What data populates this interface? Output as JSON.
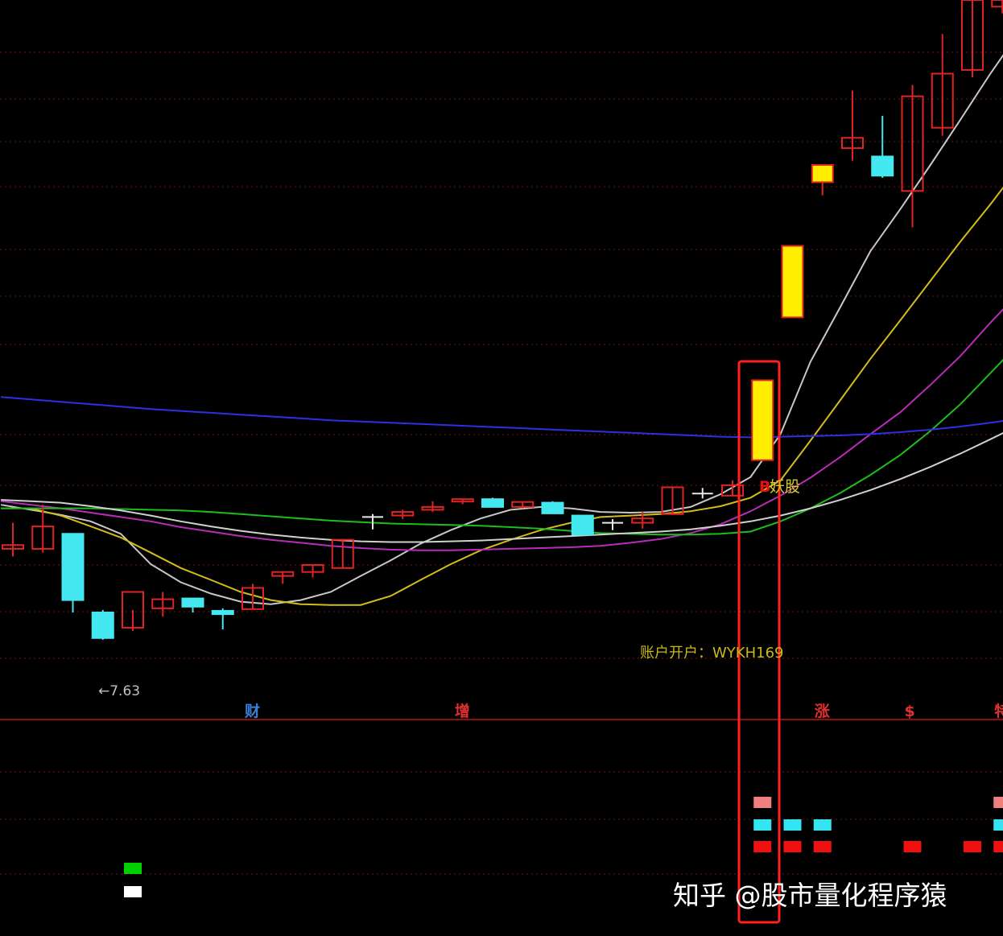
{
  "chart_data": {
    "type": "candlestick",
    "y_scale": "log",
    "y_range": [
      7.0,
      20.0
    ],
    "grid": true,
    "low_label": "←7.63",
    "candles": [
      {
        "o": 8.8,
        "h": 9.1,
        "l": 8.65,
        "c": 8.75,
        "style": "hollow-red"
      },
      {
        "o": 8.75,
        "h": 9.35,
        "l": 8.7,
        "c": 9.05,
        "style": "hollow-red"
      },
      {
        "o": 8.95,
        "h": 8.95,
        "l": 7.95,
        "c": 8.1,
        "style": "solid-cyan"
      },
      {
        "o": 7.95,
        "h": 7.98,
        "l": 7.63,
        "c": 7.65,
        "style": "solid-cyan"
      },
      {
        "o": 7.77,
        "h": 7.98,
        "l": 7.73,
        "c": 8.2,
        "style": "hollow-red"
      },
      {
        "o": 8.0,
        "h": 8.2,
        "l": 7.9,
        "c": 8.11,
        "style": "hollow-red"
      },
      {
        "o": 8.12,
        "h": 8.12,
        "l": 7.95,
        "c": 8.02,
        "style": "solid-cyan"
      },
      {
        "o": 7.97,
        "h": 8.0,
        "l": 7.75,
        "c": 7.93,
        "style": "solid-cyan"
      },
      {
        "o": 7.99,
        "h": 8.3,
        "l": 7.99,
        "c": 8.25,
        "style": "hollow-red"
      },
      {
        "o": 8.4,
        "h": 8.45,
        "l": 8.3,
        "c": 8.45,
        "style": "hollow-red"
      },
      {
        "o": 8.45,
        "h": 8.55,
        "l": 8.38,
        "c": 8.54,
        "style": "hollow-red"
      },
      {
        "o": 8.5,
        "h": 8.87,
        "l": 8.5,
        "c": 8.87,
        "style": "hollow-red"
      },
      {
        "o": 9.18,
        "h": 9.22,
        "l": 9.01,
        "c": 9.18,
        "style": "doji"
      },
      {
        "o": 9.2,
        "h": 9.28,
        "l": 9.15,
        "c": 9.25,
        "style": "hollow-red"
      },
      {
        "o": 9.28,
        "h": 9.4,
        "l": 9.25,
        "c": 9.32,
        "style": "hollow-red"
      },
      {
        "o": 9.4,
        "h": 9.43,
        "l": 9.36,
        "c": 9.43,
        "style": "hollow-red"
      },
      {
        "o": 9.43,
        "h": 9.45,
        "l": 9.32,
        "c": 9.32,
        "style": "solid-cyan"
      },
      {
        "o": 9.32,
        "h": 9.4,
        "l": 9.3,
        "c": 9.39,
        "style": "hollow-red"
      },
      {
        "o": 9.38,
        "h": 9.4,
        "l": 9.23,
        "c": 9.23,
        "style": "solid-cyan"
      },
      {
        "o": 9.2,
        "h": 9.2,
        "l": 8.93,
        "c": 8.94,
        "style": "solid-cyan"
      },
      {
        "o": 9.1,
        "h": 9.15,
        "l": 9.0,
        "c": 9.1,
        "style": "doji"
      },
      {
        "o": 9.1,
        "h": 9.25,
        "l": 9.02,
        "c": 9.16,
        "style": "hollow-red"
      },
      {
        "o": 9.22,
        "h": 9.6,
        "l": 9.22,
        "c": 9.6,
        "style": "hollow-red"
      },
      {
        "o": 9.51,
        "h": 9.59,
        "l": 9.44,
        "c": 9.51,
        "style": "doji"
      },
      {
        "o": 9.48,
        "h": 9.7,
        "l": 9.48,
        "c": 9.63,
        "style": "hollow-red"
      },
      {
        "o": 10.0,
        "h": 11.28,
        "l": 10.0,
        "c": 11.28,
        "style": "solid-yellow"
      },
      {
        "o": 12.4,
        "h": 13.81,
        "l": 12.4,
        "c": 13.81,
        "style": "solid-yellow"
      },
      {
        "o": 15.2,
        "h": 15.6,
        "l": 14.9,
        "c": 15.6,
        "style": "solid-yellow"
      },
      {
        "o": 16.0,
        "h": 17.45,
        "l": 15.7,
        "c": 16.25,
        "style": "hollow-red"
      },
      {
        "o": 15.8,
        "h": 16.8,
        "l": 15.3,
        "c": 15.35,
        "style": "solid-cyan"
      },
      {
        "o": 15.0,
        "h": 17.6,
        "l": 14.2,
        "c": 17.3,
        "style": "hollow-red"
      },
      {
        "o": 16.5,
        "h": 19.0,
        "l": 16.3,
        "c": 17.9,
        "style": "hollow-red"
      },
      {
        "o": 18.0,
        "h": 20.0,
        "l": 17.8,
        "c": 20.0,
        "style": "hollow-red"
      },
      {
        "o": 19.8,
        "h": 20.0,
        "l": 19.6,
        "c": 20.0,
        "style": "hollow-red"
      }
    ],
    "ma_lines": [
      {
        "color": "#c8c8c8",
        "values": [
          9.35,
          9.28,
          9.21,
          9.12,
          8.95,
          8.55,
          8.32,
          8.18,
          8.08,
          8.05,
          8.1,
          8.2,
          8.4,
          8.6,
          8.82,
          9.0,
          9.16,
          9.28,
          9.32,
          9.3,
          9.25,
          9.24,
          9.25,
          9.32,
          9.5,
          9.75,
          10.4,
          11.6,
          12.6,
          13.7,
          14.6,
          15.6,
          16.7,
          17.9,
          19.1
        ]
      },
      {
        "color": "#d4bd1a",
        "values": [
          9.3,
          9.3,
          9.2,
          9.05,
          8.9,
          8.7,
          8.5,
          8.35,
          8.2,
          8.1,
          8.05,
          8.04,
          8.04,
          8.15,
          8.35,
          8.55,
          8.73,
          8.87,
          9.0,
          9.1,
          9.18,
          9.2,
          9.22,
          9.26,
          9.33,
          9.45,
          9.7,
          10.3,
          10.95,
          11.65,
          12.35,
          13.1,
          13.9,
          14.7,
          15.6
        ]
      },
      {
        "color": "#b82cb8",
        "values": [
          9.4,
          9.35,
          9.3,
          9.24,
          9.18,
          9.12,
          9.04,
          8.98,
          8.92,
          8.87,
          8.83,
          8.79,
          8.76,
          8.74,
          8.73,
          8.73,
          8.74,
          8.75,
          8.76,
          8.77,
          8.79,
          8.83,
          8.88,
          8.96,
          9.08,
          9.26,
          9.48,
          9.74,
          10.05,
          10.4,
          10.75,
          11.2,
          11.7,
          12.3,
          12.9
        ]
      },
      {
        "color": "#1cbd1c",
        "values": [
          9.3,
          9.3,
          9.3,
          9.3,
          9.29,
          9.28,
          9.27,
          9.25,
          9.22,
          9.19,
          9.16,
          9.13,
          9.11,
          9.09,
          9.08,
          9.07,
          9.06,
          9.04,
          9.02,
          8.99,
          8.96,
          8.95,
          8.94,
          8.94,
          8.95,
          8.98,
          9.12,
          9.3,
          9.52,
          9.78,
          10.08,
          10.45,
          10.88,
          11.4,
          11.95
        ]
      },
      {
        "color": "#d0d0d0",
        "values": [
          9.42,
          9.4,
          9.38,
          9.33,
          9.27,
          9.2,
          9.12,
          9.05,
          8.99,
          8.94,
          8.9,
          8.87,
          8.85,
          8.84,
          8.84,
          8.85,
          8.86,
          8.88,
          8.9,
          8.92,
          8.94,
          8.96,
          8.98,
          9.01,
          9.06,
          9.12,
          9.2,
          9.3,
          9.42,
          9.56,
          9.72,
          9.9,
          10.1,
          10.32,
          10.55
        ]
      },
      {
        "color": "#2e2ee6",
        "values": [
          11.0,
          10.96,
          10.92,
          10.88,
          10.84,
          10.8,
          10.77,
          10.74,
          10.71,
          10.68,
          10.65,
          10.62,
          10.6,
          10.58,
          10.56,
          10.54,
          10.52,
          10.5,
          10.48,
          10.46,
          10.44,
          10.42,
          10.4,
          10.38,
          10.36,
          10.35,
          10.36,
          10.37,
          10.38,
          10.4,
          10.43,
          10.47,
          10.52,
          10.58,
          10.65
        ]
      }
    ],
    "signal_label": "B",
    "signal_text": "妖股",
    "account_text": "账户开户：WYKH169",
    "event_markers": [
      {
        "candle": 8,
        "text": "财",
        "color": "#3b7fd6"
      },
      {
        "candle": 15,
        "text": "增",
        "color": "#e03030"
      },
      {
        "candle": 27,
        "text": "涨",
        "color": "#e03030"
      },
      {
        "candle": 30,
        "text": "$",
        "color": "#e03030"
      },
      {
        "candle": 33,
        "text": "特",
        "color": "#e03030"
      }
    ],
    "indicator_rows": [
      {
        "color": "#f08080",
        "candles": [
          25,
          33
        ]
      },
      {
        "color": "#33e5f2",
        "candles": [
          25,
          26,
          27,
          33
        ]
      },
      {
        "color": "#f01010",
        "candles": [
          25,
          26,
          27,
          30,
          32,
          33
        ]
      },
      {
        "color": "#00d000",
        "candles": [
          4
        ]
      },
      {
        "color": "#ffffff",
        "candles": [
          4
        ]
      }
    ]
  },
  "watermark": "知乎 @股市量化程序猿"
}
